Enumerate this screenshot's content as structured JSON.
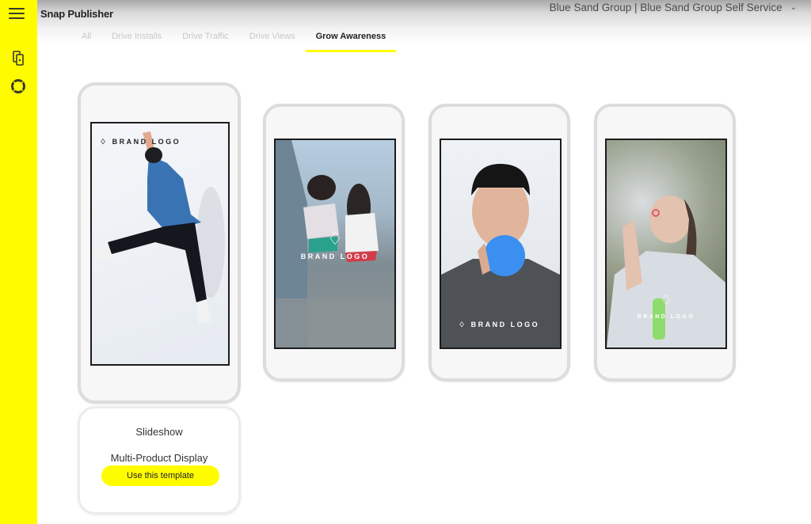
{
  "app": {
    "title": "Snap Publisher"
  },
  "account": {
    "label": "Blue Sand Group | Blue Sand Group Self Service",
    "chevron": "chevron-down-icon"
  },
  "sidebar": {
    "items": [
      {
        "icon": "menu-icon"
      },
      {
        "icon": "devices-icon"
      },
      {
        "icon": "help-lifebuoy-icon"
      }
    ]
  },
  "tabs": [
    {
      "label": "All",
      "active": false
    },
    {
      "label": "Drive Installs",
      "active": false
    },
    {
      "label": "Drive Traffic",
      "active": false
    },
    {
      "label": "Drive Views",
      "active": false
    },
    {
      "label": "Grow Awareness",
      "active": true
    }
  ],
  "templates": [
    {
      "brand_text": "BRAND LOGO",
      "scene": "man jumping in denim jacket",
      "selected": true
    },
    {
      "brand_text": "BRAND LOGO",
      "scene": "two girls walking down stairs"
    },
    {
      "brand_text": "BRAND LOGO",
      "scene": "man blowing blue bubblegum"
    },
    {
      "brand_text": "BRAND LOGO",
      "scene": "woman blowing bubbles"
    }
  ],
  "selected_template": {
    "type": "Slideshow",
    "name": "Multi-Product Display",
    "cta": "Use this template"
  },
  "colors": {
    "accent": "#FFFC00"
  }
}
